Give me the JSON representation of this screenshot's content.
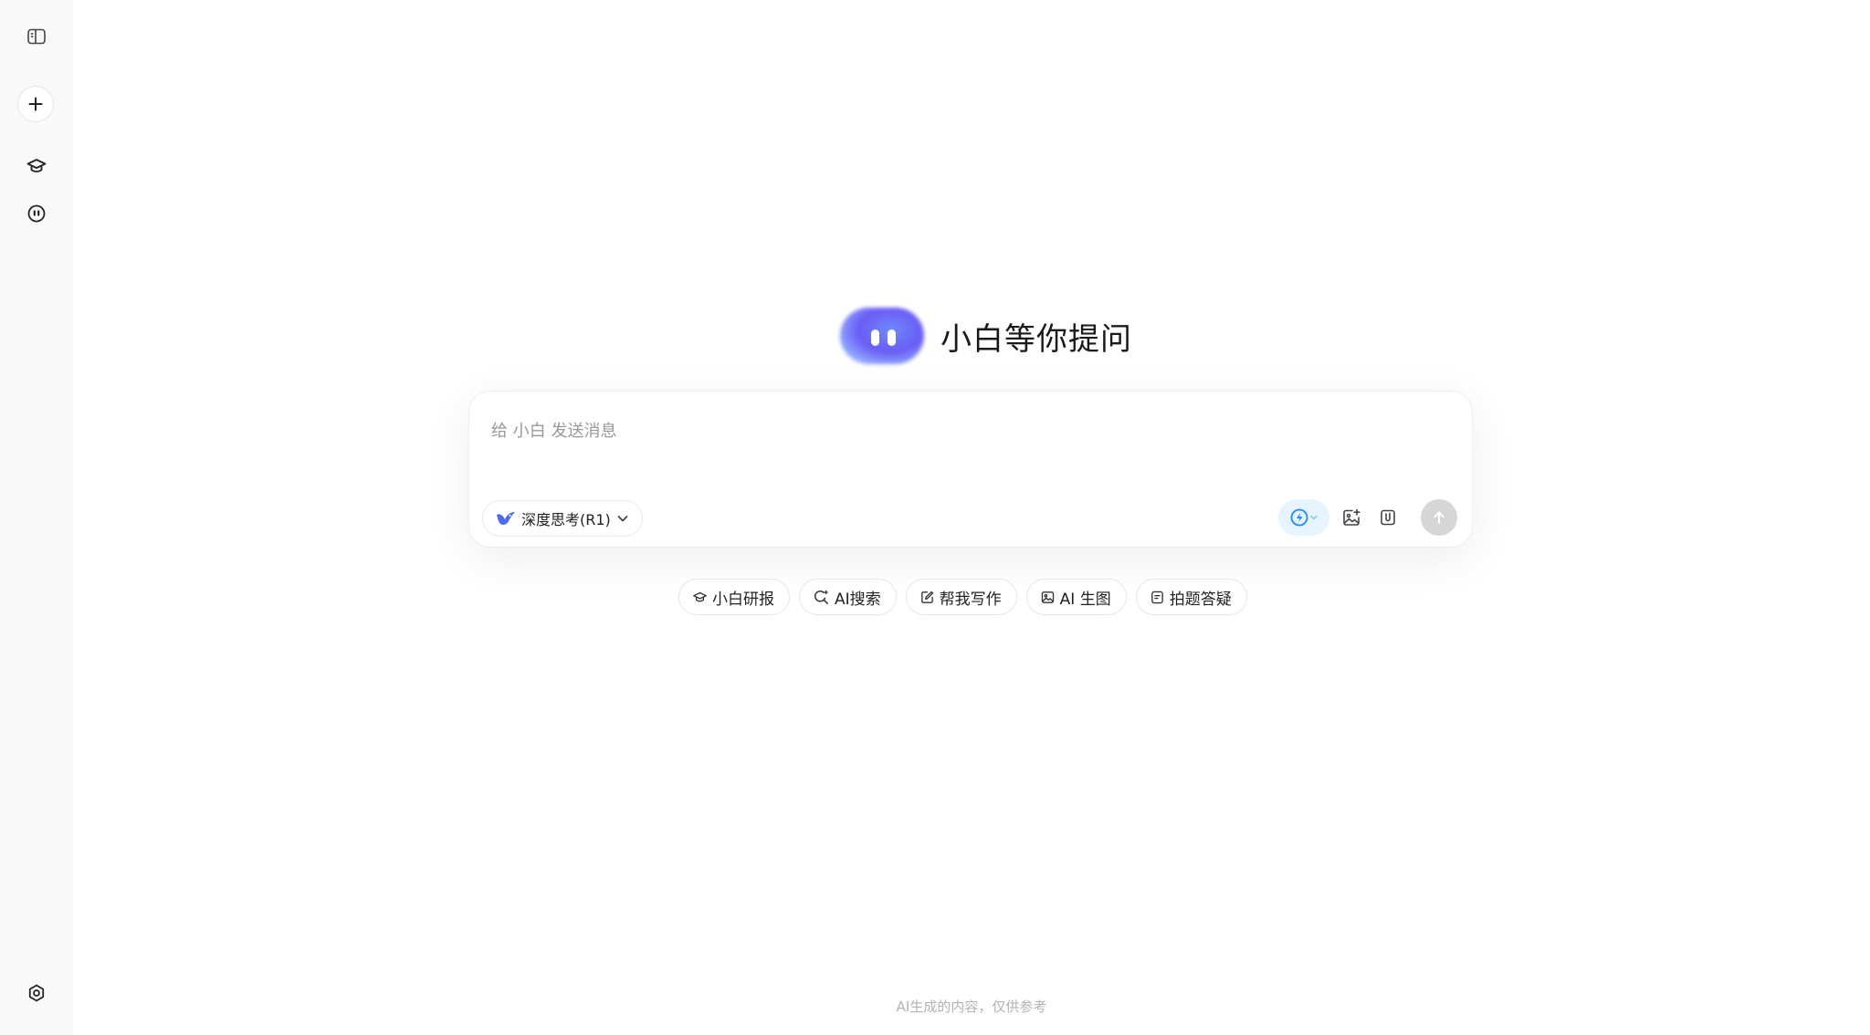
{
  "sidebar": {
    "items": [
      {
        "icon": "sidebar-toggle-icon"
      },
      {
        "icon": "plus-icon"
      },
      {
        "icon": "graduation-cap-icon"
      },
      {
        "icon": "bot-face-icon"
      },
      {
        "icon": "settings-icon"
      }
    ]
  },
  "hero": {
    "title": "小白等你提问"
  },
  "composer": {
    "placeholder": "给 小白 发送消息",
    "model_label": "深度思考(R1)",
    "accent_color": "#1e88ff"
  },
  "chips": [
    {
      "label": "小白研报",
      "icon": "graduation-cap-icon"
    },
    {
      "label": "AI搜索",
      "icon": "search-sparkle-icon"
    },
    {
      "label": "帮我写作",
      "icon": "edit-icon"
    },
    {
      "label": "AI 生图",
      "icon": "image-icon"
    },
    {
      "label": "拍题答疑",
      "icon": "note-icon"
    }
  ],
  "footer": {
    "disclaimer": "AI生成的内容，仅供参考"
  }
}
